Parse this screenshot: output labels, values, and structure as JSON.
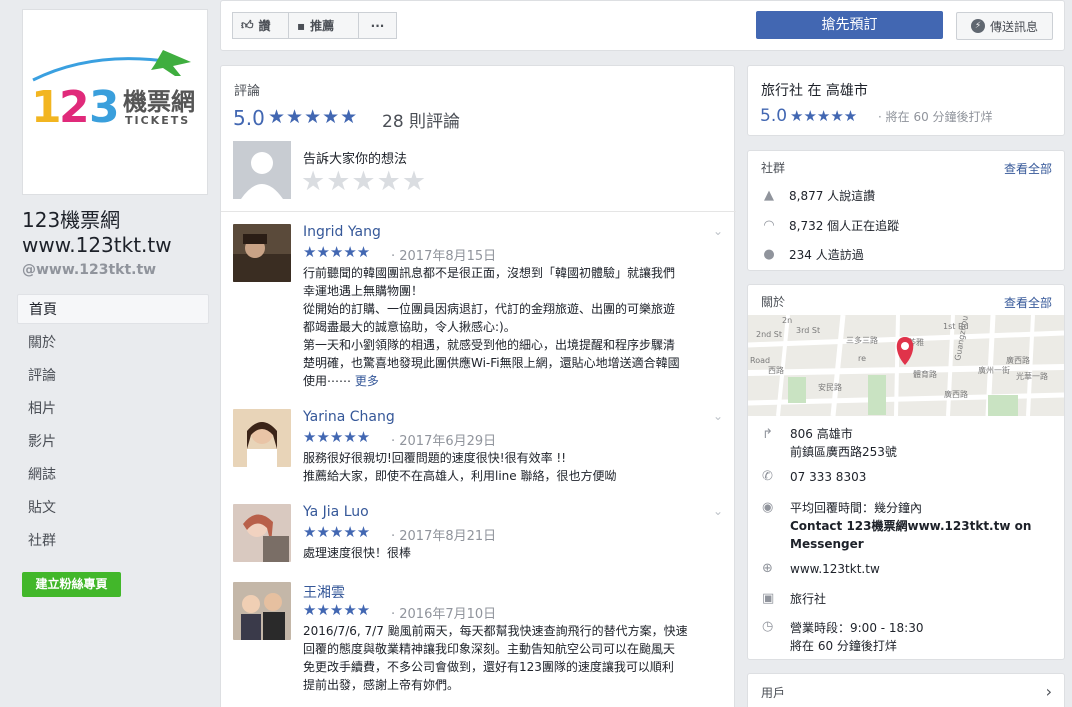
{
  "page": {
    "name_line1": "123機票網",
    "name_line2": "www.123tkt.tw",
    "handle": "@www.123tkt.tw",
    "logo": {
      "digits": "123",
      "brand": "機票網",
      "sub": "TICKETS"
    }
  },
  "nav": {
    "items": [
      "首頁",
      "關於",
      "評論",
      "相片",
      "影片",
      "網誌",
      "貼文",
      "社群"
    ],
    "create_button": "建立粉絲專頁"
  },
  "topbar": {
    "like": "讚",
    "recommend": "推薦",
    "more": "···",
    "book": "搶先預訂",
    "message": "傳送訊息"
  },
  "reviews": {
    "title": "評論",
    "rating": "5.0",
    "count": "28 則評論",
    "compose_prompt": "告訴大家你的想法",
    "items": [
      {
        "name": "Ingrid Yang",
        "date": "· 2017年8月15日",
        "rating": 5,
        "lines": [
          "行前聽聞的韓國團訊息都不是很正面，沒想到「韓國初體驗」就讓我們",
          "幸運地遇上無購物團！",
          "從開始的訂購、一位團員因病退訂，代訂的金翔旅遊、出團的可樂旅遊",
          "都竭盡最大的誠意協助，令人揪感心:)。",
          "第一天和小劉領隊的相遇，就感受到他的細心，出境提醒和程序步驟清",
          "楚明確，也驚喜地發現此團供應Wi-Fi無限上網，還貼心地增送適合韓國",
          "使用⋯⋯"
        ],
        "more": "更多"
      },
      {
        "name": "Yarina Chang",
        "date": "· 2017年6月29日",
        "rating": 5,
        "lines": [
          "服務很好很親切!回覆問題的速度很快!很有效率 !!",
          "推薦給大家，即使不在高雄人，利用line 聯絡，很也方便呦"
        ]
      },
      {
        "name": "Ya Jia Luo",
        "date": "· 2017年8月21日",
        "rating": 5,
        "lines": [
          "處理速度很快！很棒"
        ]
      },
      {
        "name": "王湘雲",
        "date": "· 2016年7月10日",
        "rating": 5,
        "lines": [
          "2016/7/6, 7/7 颱風前兩天，每天都幫我快速查詢飛行的替代方案，快速",
          "回覆的態度與敬業精神讓我印象深刻。主動告知航空公司可以在颱風天",
          "免更改手續費，不多公司會做到，還好有123團隊的速度讓我可以順利",
          "提前出發，感謝上帝有妳們。"
        ]
      }
    ]
  },
  "info": {
    "category": "旅行社 在 高雄市",
    "rating": "5.0",
    "status": "· 將在 60 分鐘後打烊"
  },
  "community": {
    "title": "社群",
    "see_all": "查看全部",
    "likes": "8,877 人說這讚",
    "followers": "8,732 個人正在追蹤",
    "visits": "234 人造訪過"
  },
  "about": {
    "title": "關於",
    "see_all": "查看全部",
    "address_line1": "806 高雄市",
    "address_line2": "前鎮區廣西路253號",
    "phone": "07 333 8303",
    "response_time": "平均回覆時間：幾分鐘內",
    "messenger_line1": "Contact 123機票網www.123tkt.tw on",
    "messenger_line2": "Messenger",
    "website": "www.123tkt.tw",
    "category": "旅行社",
    "hours": "營業時段：9:00 - 18:30",
    "hours_note": "將在 60 分鐘後打烊",
    "map_labels": [
      "3rd St",
      "三多三路",
      "1st Rd",
      "2nd St",
      "廣西路",
      "光華一路",
      "安民路",
      "體育路",
      "Guangzhou 1st St",
      "廣州一街",
      "苓雅",
      "Road",
      "2n",
      "re",
      "西路",
      "廣西路"
    ]
  },
  "users": {
    "title": "用戶"
  },
  "colors": {
    "brand_blue": "#4267b2",
    "green": "#42b72a",
    "pin_red": "#e0334a",
    "logo_plane": "#3fae3f"
  }
}
